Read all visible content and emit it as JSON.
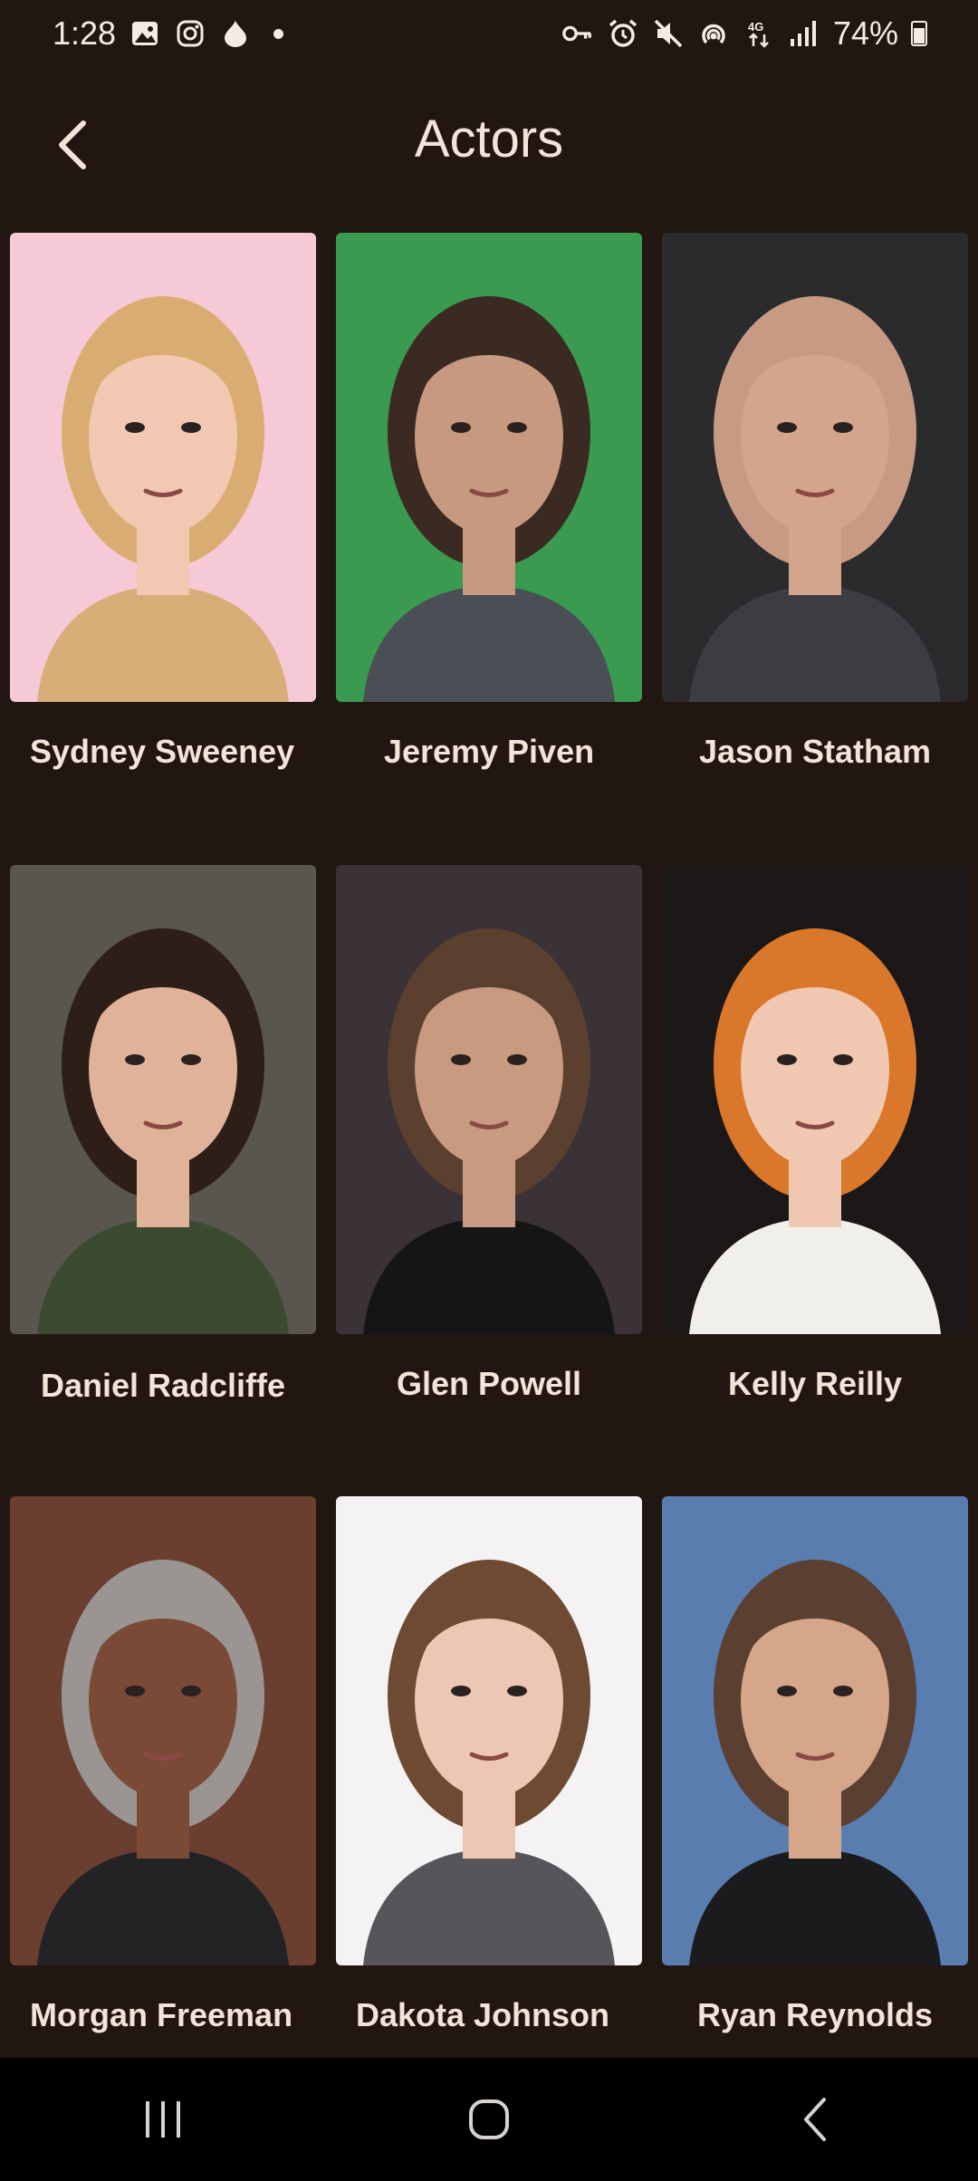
{
  "status_bar": {
    "time": "1:28",
    "battery_percent": "74%",
    "icons_left": [
      "gallery-icon",
      "instagram-icon",
      "drop-icon",
      "dot-icon"
    ],
    "icons_right": [
      "vpn-key-icon",
      "alarm-icon",
      "mute-icon",
      "hotspot-icon",
      "4g-icon",
      "signal-icon",
      "battery-icon"
    ]
  },
  "app_bar": {
    "title": "Actors",
    "back_icon": "back-arrow-icon"
  },
  "actors": [
    {
      "name": "Sydney Sweeney",
      "photo_bg": "#f6c9d6",
      "skin": "#f2c8b2",
      "hair": "#d9ad72",
      "shirt": "#d8ae78"
    },
    {
      "name": "Jeremy Piven",
      "photo_bg": "#3a9a50",
      "skin": "#c79a80",
      "hair": "#3b2a22",
      "shirt": "#4a4e55"
    },
    {
      "name": "Jason Statham",
      "photo_bg": "#2b2b2e",
      "skin": "#d4a48c",
      "hair": "#c89a84",
      "shirt": "#3c3d42"
    },
    {
      "name": "Daniel Radcliffe",
      "photo_bg": "#595650",
      "skin": "#e1b29a",
      "hair": "#2d1f17",
      "shirt": "#3d4a32"
    },
    {
      "name": "Glen Powell",
      "photo_bg": "#3a3236",
      "skin": "#c89a7f",
      "hair": "#5b4030",
      "shirt": "#151515"
    },
    {
      "name": "Kelly Reilly",
      "photo_bg": "#1c1818",
      "skin": "#f0c8b2",
      "hair": "#d9772a",
      "shirt": "#f1efea"
    },
    {
      "name": "Morgan Freeman",
      "photo_bg": "#6a3f30",
      "skin": "#7b4a37",
      "hair": "#9a9592",
      "shirt": "#232325"
    },
    {
      "name": "Dakota Johnson",
      "photo_bg": "#f4f2f2",
      "skin": "#eec7b4",
      "hair": "#6e4a33",
      "shirt": "#56565a"
    },
    {
      "name": "Ryan Reynolds",
      "photo_bg": "#5a7db0",
      "skin": "#d5a68a",
      "hair": "#5b4032",
      "shirt": "#1b1b1d"
    }
  ],
  "nav_bar": {
    "recents_icon": "recents-icon",
    "home_icon": "home-icon",
    "back_icon": "nav-back-icon"
  },
  "colors": {
    "background": "#221612",
    "text": "#f3e3d9",
    "nav_background": "#000000"
  }
}
